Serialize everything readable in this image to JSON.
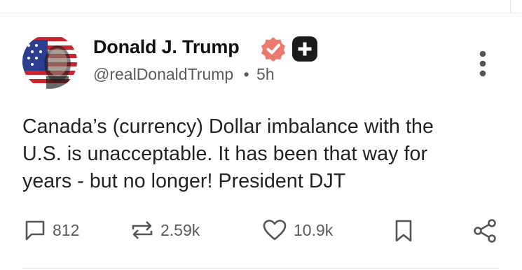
{
  "post": {
    "author_name": "Donald J. Trump",
    "handle": "@realDonaldTrump",
    "separator": "•",
    "time_ago": "5h",
    "text": "Canada’s (currency) Dollar imbalance with the\nU.S. is unacceptable. It has been that way for\nyears - but no longer! President DJT"
  },
  "actions": {
    "replies": "812",
    "restates": "2.59k",
    "likes": "10.9k"
  },
  "icons": {
    "verified": "verified-badge-icon",
    "plus": "plus-badge-icon",
    "more": "more-options-icon",
    "reply": "reply-icon",
    "restate": "restate-icon",
    "like": "heart-icon",
    "bookmark": "bookmark-icon",
    "share": "share-icon"
  },
  "colors": {
    "verified_badge": "#ea7a6f",
    "plus_badge": "#1b1b1b",
    "text_primary": "#111111",
    "text_secondary": "#5b5b5b",
    "icon_gray": "#555555"
  }
}
